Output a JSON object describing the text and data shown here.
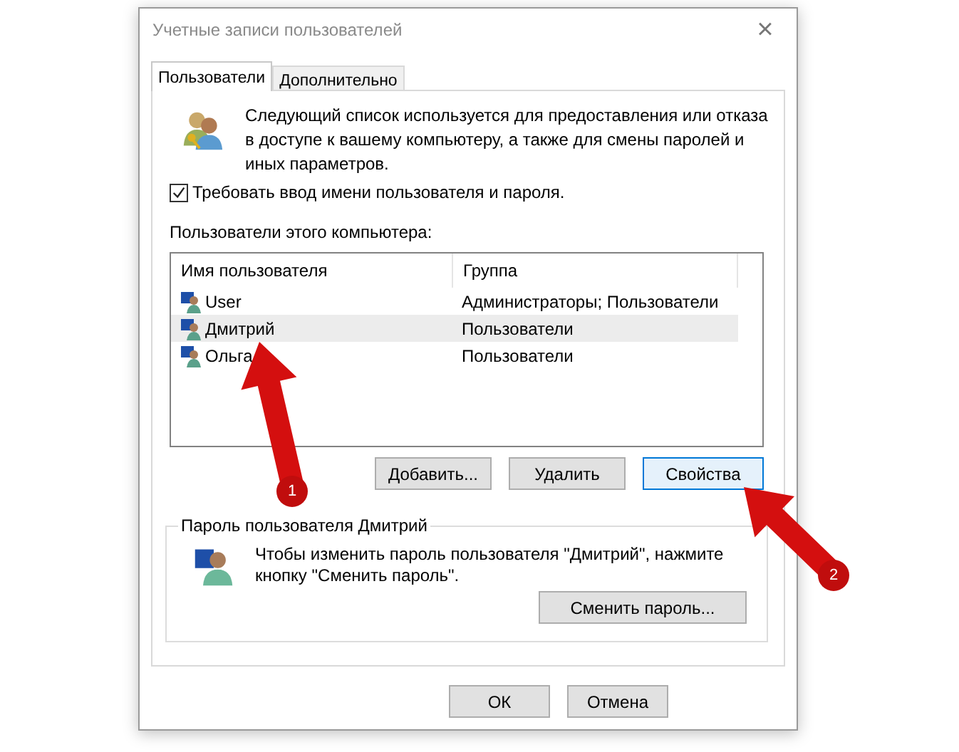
{
  "window": {
    "title": "Учетные записи пользователей",
    "close": "×"
  },
  "tabs": [
    {
      "label": "Пользователи",
      "selected": true
    },
    {
      "label": "Дополнительно",
      "selected": false
    }
  ],
  "intro": "Следующий список используется для предоставления или отказа в доступе к вашему компьютеру, а также для смены паролей и иных параметров.",
  "require_login": {
    "label": "Требовать ввод имени пользователя и пароля.",
    "checked": true
  },
  "users_label": "Пользователи этого компьютера:",
  "table": {
    "columns": [
      "Имя пользователя",
      "Группа"
    ],
    "rows": [
      {
        "name": "User",
        "group": "Администраторы; Пользователи",
        "selected": false
      },
      {
        "name": "Дмитрий",
        "group": "Пользователи",
        "selected": true
      },
      {
        "name": "Ольга",
        "group": "Пользователи",
        "selected": false
      }
    ]
  },
  "list_buttons": [
    {
      "label": "Добавить...",
      "focused": false
    },
    {
      "label": "Удалить",
      "focused": false
    },
    {
      "label": "Свойства",
      "focused": true
    }
  ],
  "password_group": {
    "title": "Пароль пользователя Дмитрий",
    "text": "Чтобы изменить пароль пользователя \"Дмитрий\", нажмите кнопку \"Сменить пароль\".",
    "button": "Сменить пароль..."
  },
  "footer_buttons": [
    "ОК",
    "Отмена"
  ],
  "annotations": [
    {
      "number": "1"
    },
    {
      "number": "2"
    }
  ]
}
